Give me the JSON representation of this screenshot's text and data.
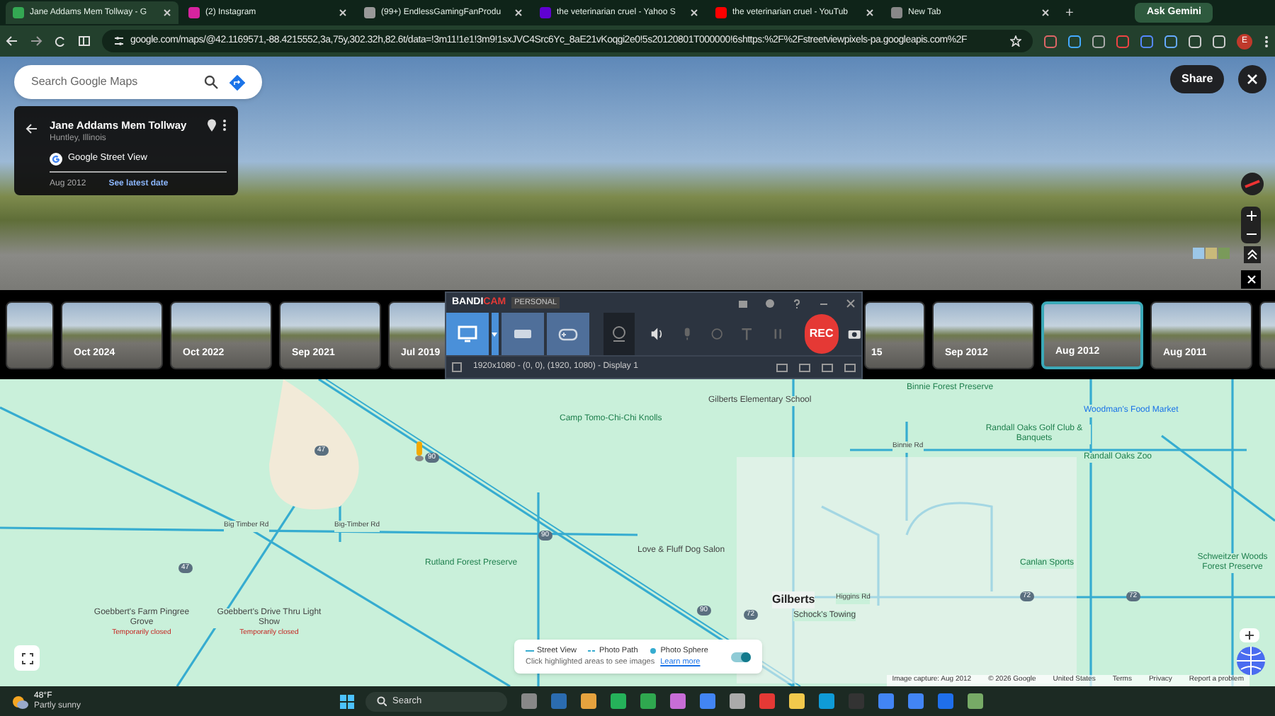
{
  "browser": {
    "tabs": [
      {
        "title": "Jane Addams Mem Tollway - G",
        "selected": true
      },
      {
        "title": "(2) Instagram",
        "selected": false
      },
      {
        "title": "(99+) EndlessGamingFanProdu",
        "selected": false
      },
      {
        "title": "the veterinarian cruel - Yahoo S",
        "selected": false
      },
      {
        "title": "the veterinarian cruel - YouTub",
        "selected": false
      },
      {
        "title": "New Tab",
        "selected": false
      }
    ],
    "new_tab": "+",
    "ask_gemini": "Ask Gemini",
    "url": "google.com/maps/@42.1169571,-88.4215552,3a,75y,302.32h,82.6t/data=!3m11!1e1!3m9!1sxJVC4Src6Yc_8aE21vKoqgi2e0!5s20120801T000000!6shttps:%2F%2Fstreetviewpixels-pa.googleapis.com%2F",
    "profile": "E"
  },
  "search": {
    "placeholder": "Search Google Maps"
  },
  "place_card": {
    "title": "Jane Addams Mem Tollway",
    "subtitle": "Huntley, Illinois",
    "source": "Google Street View",
    "date": "Aug 2012",
    "link": "See latest date"
  },
  "share": "Share",
  "timeline": {
    "left": [
      {
        "selected": false
      },
      {
        "label": "Oct 2024",
        "selected": false
      },
      {
        "label": "Oct 2022",
        "selected": false
      },
      {
        "label": "Sep 2021",
        "selected": false
      },
      {
        "label": "Jul 2019",
        "selected": false
      }
    ],
    "right": [
      {
        "label": "15",
        "selected": false
      },
      {
        "label": "Sep 2012",
        "selected": false
      },
      {
        "label": "Aug 2012",
        "selected": true
      },
      {
        "label": "Aug 2011",
        "selected": false
      },
      {
        "selected": false
      }
    ]
  },
  "recorder": {
    "logo_a": "BANDI",
    "logo_b": "CAM",
    "edition": "PERSONAL",
    "rec": "REC",
    "area": "1920x1080 - (0, 0), (1920, 1080) - Display 1"
  },
  "map": {
    "labels": [
      {
        "text": "Gilberts Elementary School",
        "kind": "poi"
      },
      {
        "text": "Camp Tomo-Chi-Chi Knolls",
        "kind": "park"
      },
      {
        "text": "Binnie Forest Preserve",
        "kind": "park"
      },
      {
        "text": "Woodman's Food Market",
        "kind": "shop"
      },
      {
        "text": "Randall Oaks Golf Club & Banquets",
        "kind": "park"
      },
      {
        "text": "Randall Oaks Zoo",
        "kind": "park"
      },
      {
        "text": "Binnie Rd",
        "kind": "road"
      },
      {
        "text": "Big Timber Rd",
        "kind": "road"
      },
      {
        "text": "Big-Timber Rd",
        "kind": "road"
      },
      {
        "text": "Rutland Forest Preserve",
        "kind": "park"
      },
      {
        "text": "Love & Fluff Dog Salon",
        "kind": "poi"
      },
      {
        "text": "Canlan Sports",
        "kind": "park"
      },
      {
        "text": "Schweitzer Woods Forest Preserve",
        "kind": "park"
      },
      {
        "text": "Gilberts",
        "kind": "town"
      },
      {
        "text": "Higgins Rd",
        "kind": "road"
      },
      {
        "text": "Goebbert's Farm Pingree Grove",
        "kind": "poi",
        "note": "Temporarily closed"
      },
      {
        "text": "Goebbert's Drive Thru Light Show",
        "kind": "poi",
        "note": "Temporarily closed"
      },
      {
        "text": "Schock's Towing",
        "kind": "poi"
      },
      {
        "text": "47",
        "kind": "shield"
      },
      {
        "text": "47",
        "kind": "shield"
      },
      {
        "text": "90",
        "kind": "shield"
      },
      {
        "text": "90",
        "kind": "shield"
      },
      {
        "text": "90",
        "kind": "shield"
      },
      {
        "text": "72",
        "kind": "shield"
      },
      {
        "text": "72",
        "kind": "shield"
      },
      {
        "text": "72",
        "kind": "shield"
      }
    ],
    "legend": {
      "items": [
        "Street View",
        "Photo Path",
        "Photo Sphere"
      ],
      "hint": "Click highlighted areas to see images",
      "link": "Learn more",
      "on": true
    },
    "footer": [
      "Image capture: Aug 2012",
      "© 2026 Google",
      "United States",
      "Terms",
      "Privacy",
      "Report a problem"
    ]
  },
  "taskbar": {
    "temp": "48°F",
    "weather": "Partly sunny",
    "search": "Search"
  }
}
